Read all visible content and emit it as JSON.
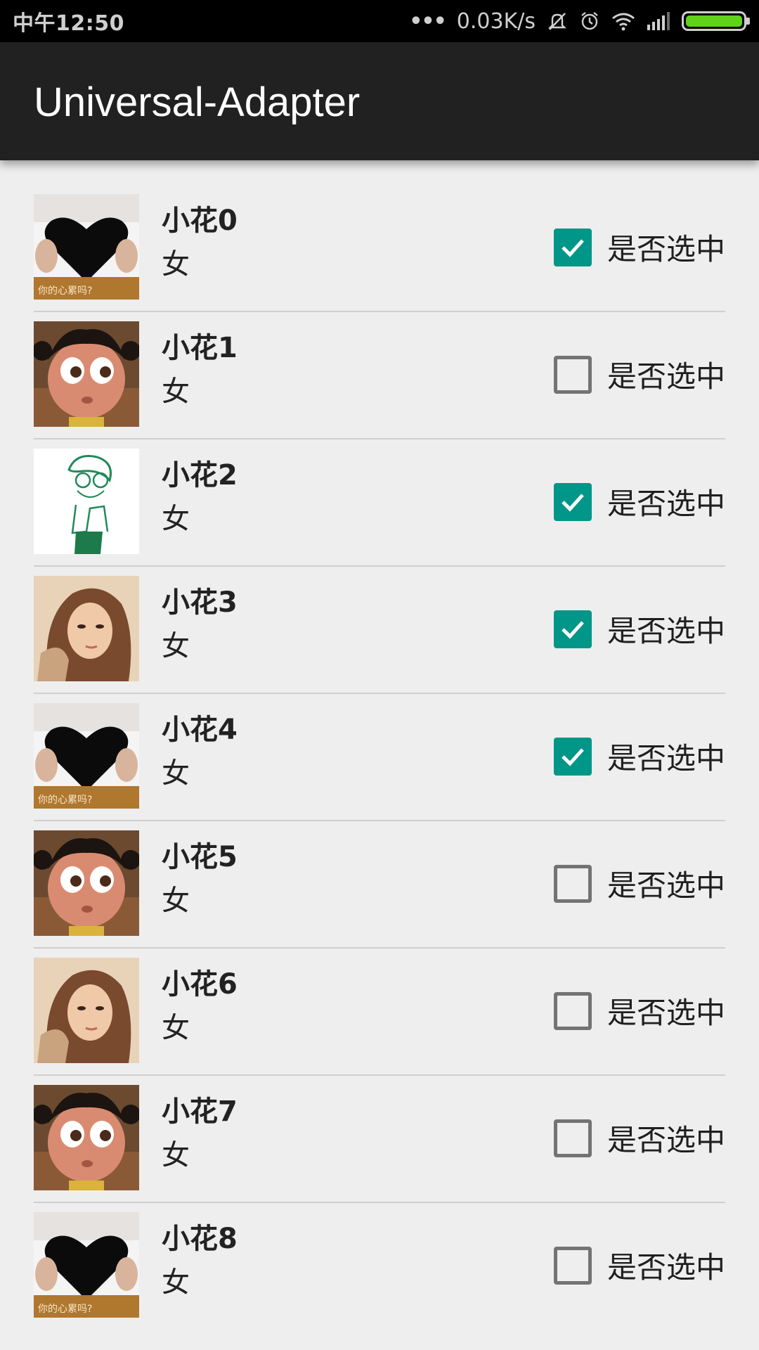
{
  "status_bar": {
    "time": "中午12:50",
    "dots": "•••",
    "network_speed": "0.03K/s",
    "icons": [
      "notification-muted-icon",
      "alarm-icon",
      "wifi-icon",
      "signal-icon",
      "battery-icon"
    ],
    "battery_level": 1.0,
    "battery_color": "#5fd31a"
  },
  "app_bar": {
    "title": "Universal-Adapter",
    "background": "#212121"
  },
  "colors": {
    "accent": "#009688",
    "background": "#eeeeee"
  },
  "list": {
    "items": [
      {
        "name": "小花0",
        "gender": "女",
        "checkbox_label": "是否选中",
        "checked": true,
        "avatar": "heart-girl"
      },
      {
        "name": "小花1",
        "gender": "女",
        "checkbox_label": "是否选中",
        "checked": false,
        "avatar": "cartoon-girl"
      },
      {
        "name": "小花2",
        "gender": "女",
        "checkbox_label": "是否选中",
        "checked": true,
        "avatar": "sketch-boy"
      },
      {
        "name": "小花3",
        "gender": "女",
        "checkbox_label": "是否选中",
        "checked": true,
        "avatar": "portrait-woman"
      },
      {
        "name": "小花4",
        "gender": "女",
        "checkbox_label": "是否选中",
        "checked": true,
        "avatar": "heart-girl"
      },
      {
        "name": "小花5",
        "gender": "女",
        "checkbox_label": "是否选中",
        "checked": false,
        "avatar": "cartoon-girl"
      },
      {
        "name": "小花6",
        "gender": "女",
        "checkbox_label": "是否选中",
        "checked": false,
        "avatar": "portrait-woman"
      },
      {
        "name": "小花7",
        "gender": "女",
        "checkbox_label": "是否选中",
        "checked": false,
        "avatar": "cartoon-girl"
      },
      {
        "name": "小花8",
        "gender": "女",
        "checkbox_label": "是否选中",
        "checked": false,
        "avatar": "heart-girl"
      }
    ]
  }
}
